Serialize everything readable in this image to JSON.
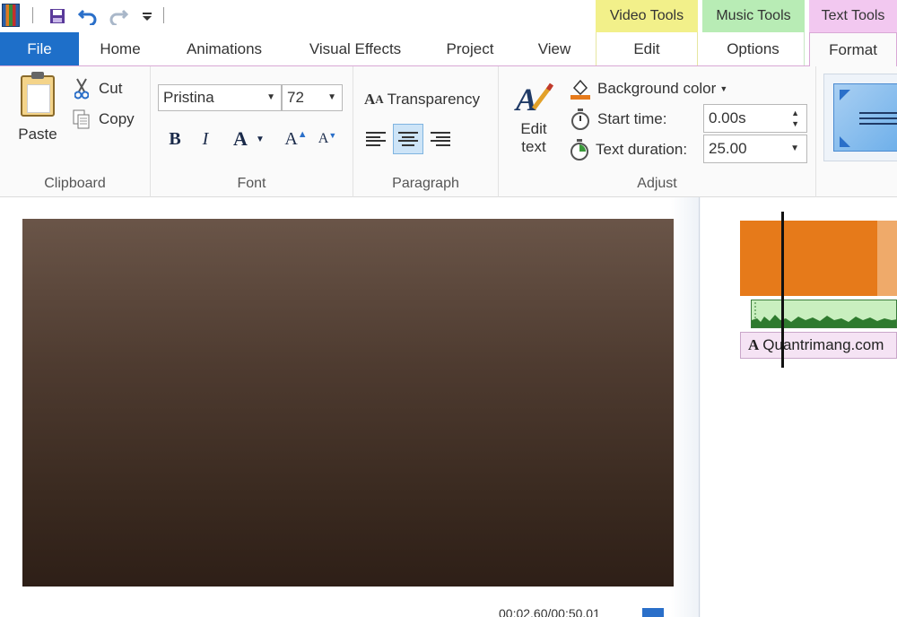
{
  "quick_access": {
    "icons": [
      "app-icon",
      "save-icon",
      "undo-icon",
      "redo-icon",
      "customize-qat-icon"
    ]
  },
  "context_tabs": {
    "video_tools": "Video Tools",
    "music_tools": "Music Tools",
    "text_tools": "Text Tools"
  },
  "tabs": {
    "file": "File",
    "home": "Home",
    "animations": "Animations",
    "visual_effects": "Visual Effects",
    "project": "Project",
    "view": "View",
    "edit": "Edit",
    "options": "Options",
    "format": "Format"
  },
  "ribbon": {
    "clipboard": {
      "label": "Clipboard",
      "paste": "Paste",
      "cut": "Cut",
      "copy": "Copy"
    },
    "font": {
      "label": "Font",
      "family": "Pristina",
      "size": "72",
      "bold": "B",
      "italic": "I",
      "color": "A",
      "grow": "A",
      "shrink": "A"
    },
    "paragraph": {
      "label": "Paragraph",
      "transparency": "Transparency"
    },
    "adjust": {
      "label": "Adjust",
      "edit_text_line1": "Edit",
      "edit_text_line2": "text",
      "background_color": "Background color",
      "start_time_label": "Start time:",
      "start_time_value": "0.00s",
      "text_duration_label": "Text duration:",
      "text_duration_value": "25.00"
    }
  },
  "preview": {
    "timecode": "00:02.60/00:50.01"
  },
  "timeline": {
    "text_clip": "Quantrimang.com"
  },
  "colors": {
    "file_tab": "#1e6fc9",
    "video_tools": "#f2f08a",
    "music_tools": "#b8ecb5",
    "text_tools": "#f2c8f0",
    "video_clip": "#e67a1a",
    "audio_clip": "#c9efbf",
    "text_clip": "#f5e3f4"
  }
}
